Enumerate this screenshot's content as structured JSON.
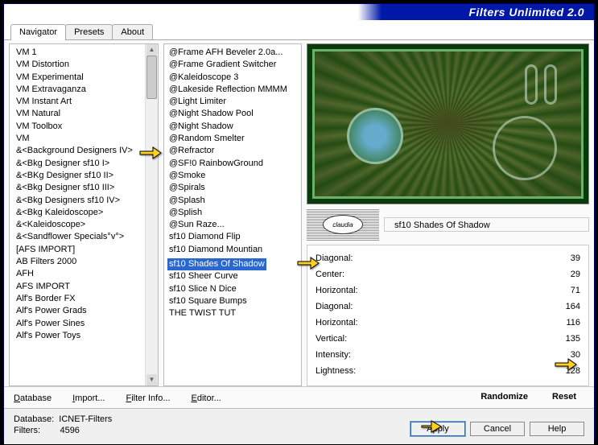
{
  "title": "Filters Unlimited 2.0",
  "tabs": [
    "Navigator",
    "Presets",
    "About"
  ],
  "active_tab": 0,
  "col1": [
    "VM 1",
    "VM Distortion",
    "VM Experimental",
    "VM Extravaganza",
    "VM Instant Art",
    "VM Natural",
    "VM Toolbox",
    "VM",
    "&<Background Designers IV>",
    "&<Bkg Designer sf10 I>",
    "&<BKg Designer sf10 II>",
    "&<Bkg Designer sf10 III>",
    "&<Bkg Designers sf10 IV>",
    "&<Bkg Kaleidoscope>",
    "&<Kaleidoscope>",
    "&<Sandflower Specials°v°>",
    "[AFS IMPORT]",
    "AB Filters 2000",
    "AFH",
    "AFS IMPORT",
    "Alf's Border FX",
    "Alf's Power Grads",
    "Alf's Power Sines",
    "Alf's Power Toys"
  ],
  "col1_sel": 8,
  "col2": [
    "@Frame AFH Beveler 2.0a...",
    "@Frame Gradient Switcher",
    "@Kaleidoscope 3",
    "@Lakeside Reflection MMMM",
    "@Light Limiter",
    "@Night Shadow Pool",
    "@Night Shadow",
    "@Random Smelter",
    "@Refractor",
    "@SF!0 RainbowGround",
    "@Smoke",
    "@Spirals",
    "@Splash",
    "@Splish",
    "@Sun Raze...",
    "sf10 Diamond Flip",
    "sf10 Diamond Mountian",
    "sf10 Shades Of Shadow",
    "sf10 Sheer Curve",
    "sf10 Slice N Dice",
    "sf10 Square Bumps",
    "THE TWIST TUT"
  ],
  "col2_sel": 17,
  "filter_name": "sf10 Shades Of Shadow",
  "claudia": "claudia",
  "params": [
    {
      "label": "Diagonal:",
      "val": 39
    },
    {
      "label": "Center:",
      "val": 29
    },
    {
      "label": "Horizontal:",
      "val": 71
    },
    {
      "label": "Diagonal:",
      "val": 164
    },
    {
      "label": "Horizontal:",
      "val": 116
    },
    {
      "label": "Vertical:",
      "val": 135
    },
    {
      "label": "Intensity:",
      "val": 30
    },
    {
      "label": "Lightness:",
      "val": 128
    }
  ],
  "btnrow": {
    "database": "Database",
    "import": "Import...",
    "filterinfo": "Filter Info...",
    "editor": "Editor...",
    "randomize": "Randomize",
    "reset": "Reset"
  },
  "footer": {
    "db_label": "Database:",
    "db_val": "ICNET-Filters",
    "filters_label": "Filters:",
    "filters_val": "4596"
  },
  "buttons": {
    "apply": "Apply",
    "cancel": "Cancel",
    "help": "Help"
  }
}
